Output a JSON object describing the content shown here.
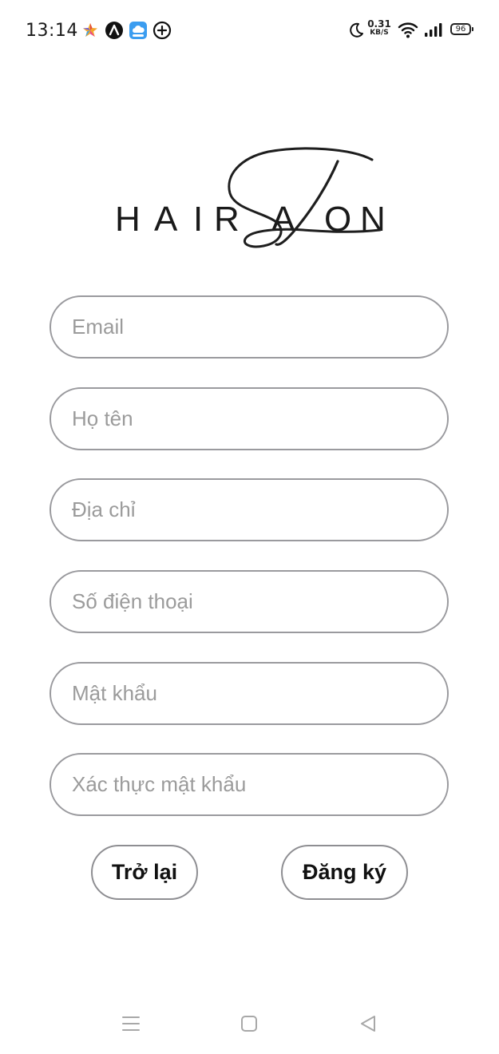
{
  "status_bar": {
    "time": "13:14",
    "net_speed_value": "0.31",
    "net_speed_unit": "KB/S",
    "battery": "96",
    "icons": [
      "colorful-star-app-icon",
      "a-circle-app-icon",
      "blue-cloud-app-icon",
      "plus-circle-icon",
      "moon-icon",
      "wifi-icon",
      "signal-icon",
      "battery-icon"
    ]
  },
  "logo": {
    "letters": [
      "H",
      "A",
      "I",
      "R",
      "A",
      "O",
      "N"
    ]
  },
  "form": {
    "fields": [
      {
        "placeholder": "Email",
        "value": ""
      },
      {
        "placeholder": "Họ tên",
        "value": ""
      },
      {
        "placeholder": "Địa chỉ",
        "value": ""
      },
      {
        "placeholder": "Số điện thoại",
        "value": ""
      },
      {
        "placeholder": "Mật khẩu",
        "value": ""
      },
      {
        "placeholder": "Xác thực mật khẩu",
        "value": ""
      }
    ],
    "back_label": "Trở lại",
    "register_label": "Đăng ký"
  },
  "nav_bar": {
    "icons": [
      "menu-icon",
      "home-square-icon",
      "back-triangle-icon"
    ]
  },
  "colors": {
    "border": "#9a9a9e",
    "placeholder": "#9b9b9b",
    "text": "#111111",
    "background": "#ffffff"
  }
}
